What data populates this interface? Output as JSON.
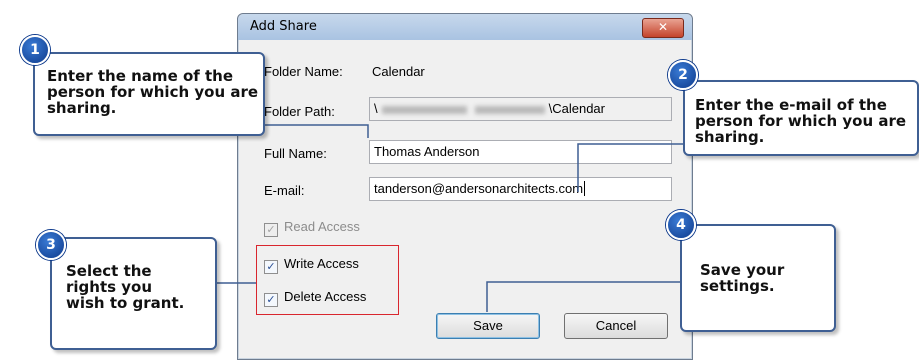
{
  "dialog": {
    "title": "Add Share",
    "close_glyph": "✕",
    "folder_name_label": "Folder Name:",
    "folder_name_value": "Calendar",
    "folder_path_label": "Folder Path:",
    "folder_path_prefix": "\\",
    "folder_path_suffix": "\\Calendar",
    "full_name_label": "Full Name:",
    "full_name_value": "Thomas Anderson",
    "email_label": "E-mail:",
    "email_value": "tanderson@andersonarchitects.com",
    "read_access_label": "Read Access",
    "write_access_label": "Write Access",
    "delete_access_label": "Delete Access",
    "save_label": "Save",
    "cancel_label": "Cancel",
    "check_glyph": "✓"
  },
  "callouts": [
    {
      "number": "1",
      "text": "Enter the name of the person for which you are sharing."
    },
    {
      "number": "2",
      "text": "Enter the e-mail of the person for which you are sharing."
    },
    {
      "number": "3",
      "text": "Select the rights you wish to grant."
    },
    {
      "number": "4",
      "text": "Save your settings."
    }
  ],
  "colors": {
    "callout_border": "#3f5f93",
    "badge": "#1f5bbf",
    "highlight": "#d9262e"
  }
}
